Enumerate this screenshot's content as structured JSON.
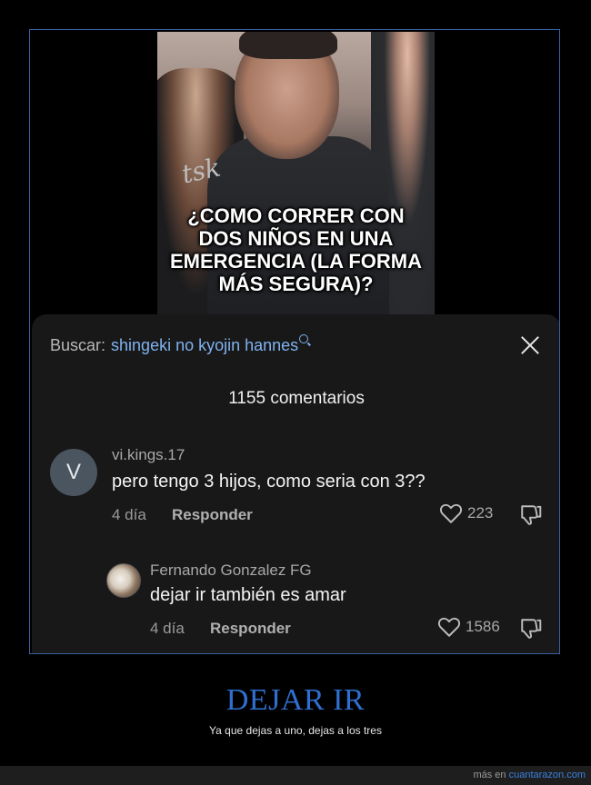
{
  "video": {
    "caption_lines": [
      "¿COMO CORRER CON",
      "DOS NIÑOS EN UNA",
      "EMERGENCIA (LA FORMA",
      "MÁS SEGURA)?"
    ]
  },
  "search": {
    "label": "Buscar:",
    "query": "shingeki no kyojin hannes"
  },
  "comments_count": "1155 comentarios",
  "comments": [
    {
      "avatar_letter": "V",
      "username": "vi.kings.17",
      "text": "pero tengo 3 hijos, como seria con 3??",
      "time": "4 día",
      "reply_label": "Responder",
      "likes": "223"
    },
    {
      "username": "Fernando Gonzalez FG",
      "text": "dejar ir también es amar",
      "time": "4 día",
      "reply_label": "Responder",
      "likes": "1586"
    }
  ],
  "headline": "DEJAR IR",
  "subline": "Ya que dejas a uno, dejas a los tres",
  "footer": {
    "prefix": "más en",
    "site": "cuantarazon.com"
  },
  "colors": {
    "frame_border": "#3d5fa8",
    "search_query": "#7fb2f0",
    "headline": "#2f6fcf",
    "footer_link": "#3a82e0"
  }
}
